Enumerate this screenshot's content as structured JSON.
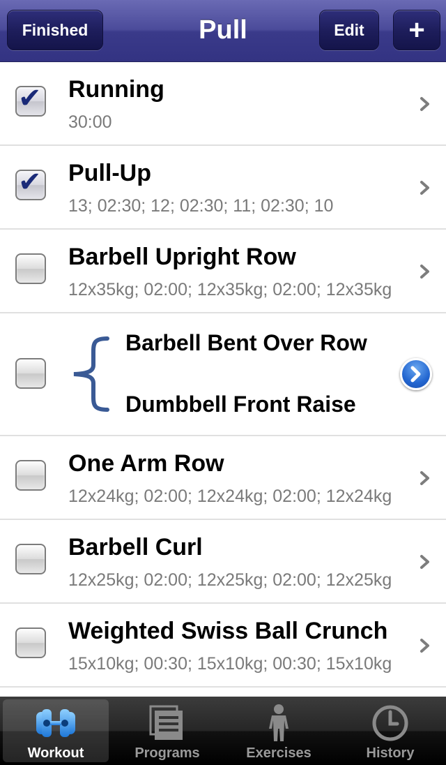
{
  "navbar": {
    "title": "Pull",
    "finished_label": "Finished",
    "edit_label": "Edit",
    "add_label": "+"
  },
  "exercises": [
    {
      "name": "Running",
      "detail": "30:00",
      "checked": true
    },
    {
      "name": "Pull-Up",
      "detail": "13; 02:30; 12; 02:30; 11; 02:30; 10",
      "checked": true
    },
    {
      "name": "Barbell Upright Row",
      "detail": "12x35kg; 02:00; 12x35kg; 02:00; 12x35kg",
      "checked": false
    },
    {
      "superset": [
        "Barbell Bent Over Row",
        "Dumbbell Front Raise"
      ],
      "checked": false
    },
    {
      "name": "One Arm Row",
      "detail": "12x24kg; 02:00; 12x24kg; 02:00; 12x24kg",
      "checked": false
    },
    {
      "name": "Barbell Curl",
      "detail": "12x25kg; 02:00; 12x25kg; 02:00; 12x25kg",
      "checked": false
    },
    {
      "name": "Weighted Swiss Ball Crunch",
      "detail": "15x10kg; 00:30; 15x10kg; 00:30; 15x10kg",
      "checked": false
    }
  ],
  "tabs": [
    {
      "label": "Workout",
      "icon": "workout-icon",
      "active": true
    },
    {
      "label": "Programs",
      "icon": "programs-icon",
      "active": false
    },
    {
      "label": "Exercises",
      "icon": "exercises-icon",
      "active": false
    },
    {
      "label": "History",
      "icon": "history-icon",
      "active": false
    }
  ],
  "colors": {
    "navbar": "#4b4b9a",
    "checkmark": "#1a2a78",
    "brace": "#3a5a95",
    "disclosure": "#2366d0",
    "subtitle": "#7a7a7a"
  }
}
